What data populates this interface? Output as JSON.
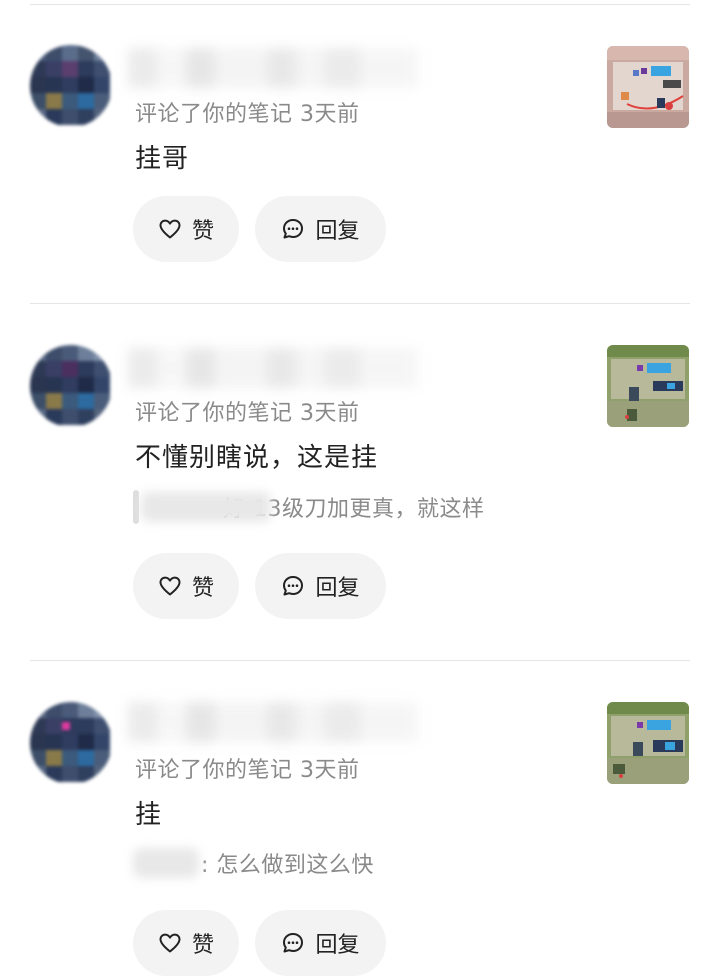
{
  "items": [
    {
      "meta": "评论了你的笔记  3天前",
      "content": "挂哥",
      "quote": null,
      "like_label": "赞",
      "reply_label": "回复"
    },
    {
      "meta": "评论了你的笔记  3天前",
      "content": "不懂别瞎说，这是挂",
      "quote": "好 13级刀加更真，就这样",
      "like_label": "赞",
      "reply_label": "回复"
    },
    {
      "meta": "评论了你的笔记  3天前",
      "content": "挂",
      "quote": ": 怎么做到这么快",
      "like_label": "赞",
      "reply_label": "回复"
    }
  ],
  "colors": {
    "meta_text": "#8a8a8a",
    "content_text": "#222222",
    "pill_bg": "#f3f3f3",
    "divider": "#e6e6e6"
  },
  "icons": {
    "like": "heart-icon",
    "reply": "chat-bubble-icon"
  }
}
